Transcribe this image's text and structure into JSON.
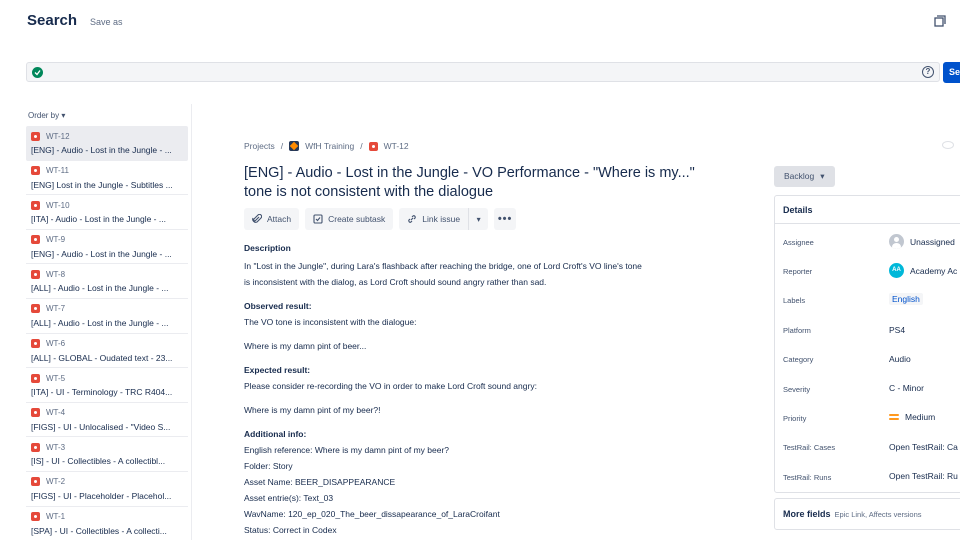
{
  "header": {
    "title": "Search",
    "save_as": "Save as",
    "fullscreen_icon": "fullscreen-icon"
  },
  "search": {
    "status_icon": "check-icon",
    "help_icon": "help-icon",
    "help_glyph": "?",
    "button_label": "Se"
  },
  "sidebar": {
    "order_by": "Order by",
    "items": [
      {
        "key": "WT-12",
        "summary": "[ENG] - Audio - Lost in the Jungle - ..."
      },
      {
        "key": "WT-11",
        "summary": "[ENG] Lost in the Jungle - Subtitles ..."
      },
      {
        "key": "WT-10",
        "summary": "[ITA] - Audio - Lost in the Jungle - ..."
      },
      {
        "key": "WT-9",
        "summary": "[ENG] - Audio - Lost in the Jungle - ..."
      },
      {
        "key": "WT-8",
        "summary": "[ALL] - Audio - Lost in the Jungle - ..."
      },
      {
        "key": "WT-7",
        "summary": "[ALL] - Audio - Lost in the Jungle - ..."
      },
      {
        "key": "WT-6",
        "summary": "[ALL] - GLOBAL - Oudated text - 23..."
      },
      {
        "key": "WT-5",
        "summary": "[ITA] - UI - Terminology - TRC R404..."
      },
      {
        "key": "WT-4",
        "summary": "[FIGS] - UI - Unlocalised - \"Video S..."
      },
      {
        "key": "WT-3",
        "summary": "[IS] - UI - Collectibles - A collectibl..."
      },
      {
        "key": "WT-2",
        "summary": "[FIGS] - UI - Placeholder - Placehol..."
      },
      {
        "key": "WT-1",
        "summary": "[SPA] - UI - Collectibles - A collecti..."
      }
    ]
  },
  "breadcrumb": {
    "projects": "Projects",
    "project": "WfH Training",
    "issue": "WT-12",
    "separator": "/"
  },
  "issue": {
    "title": "[ENG] - Audio - Lost in the Jungle - VO Performance - \"Where is my...\" tone is not consistent with the dialogue",
    "actions": {
      "attach": "Attach",
      "create_subtask": "Create subtask",
      "link_issue": "Link issue",
      "more": "•••"
    },
    "description": {
      "heading": "Description",
      "intro_1": "In \"Lost in the Jungle\", during Lara's flashback after reaching the bridge, one of Lord Croft's VO line's tone",
      "intro_2": "is inconsistent with the dialog, as Lord Croft should sound angry rather than sad.",
      "observed_heading": "Observed result:",
      "observed_1": "The VO tone is inconsistent with the dialogue:",
      "observed_2": "Where is my damn pint of beer...",
      "expected_heading": "Expected result:",
      "expected_1": "Please consider re-recording the VO in order to make Lord Croft sound angry:",
      "expected_2": "Where is my damn pint of my beer?!",
      "additional_heading": "Additional info:",
      "info_1": "English reference: Where is my damn pint of my beer?",
      "info_2": "Folder: Story",
      "info_3": "Asset Name: BEER_DISAPPEARANCE",
      "info_4": "Asset entrie(s): Text_03",
      "info_5": "WavName: 120_ep_020_The_beer_dissapearance_of_LaraCroifant",
      "info_6": "Status: Correct in Codex"
    }
  },
  "status": {
    "label": "Backlog"
  },
  "details": {
    "header": "Details",
    "assignee_label": "Assignee",
    "assignee_value": "Unassigned",
    "reporter_label": "Reporter",
    "reporter_initials": "AA",
    "reporter_value": "Academy Ac",
    "labels_label": "Labels",
    "labels_value": "English",
    "platform_label": "Platform",
    "platform_value": "PS4",
    "category_label": "Category",
    "category_value": "Audio",
    "severity_label": "Severity",
    "severity_value": "C - Minor",
    "priority_label": "Priority",
    "priority_value": "Medium",
    "testrail_cases_label": "TestRail: Cases",
    "testrail_cases_value": "Open TestRail: Ca",
    "testrail_runs_label": "TestRail: Runs",
    "testrail_runs_value": "Open TestRail: Ru",
    "more_fields": "More fields",
    "more_fields_hint": "Epic Link, Affects versions"
  },
  "colors": {
    "accent": "#0052cc",
    "bug": "#e5493a",
    "success": "#00875a",
    "priority_medium": "#ff991f"
  }
}
